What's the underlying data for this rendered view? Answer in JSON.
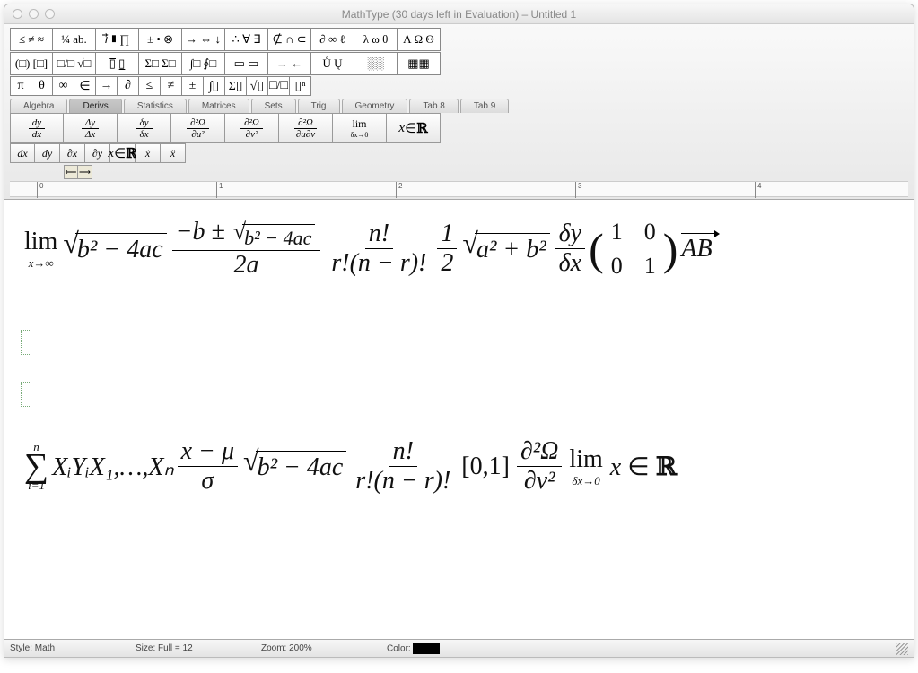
{
  "window": {
    "title": "MathType (30 days left in Evaluation) – Untitled 1"
  },
  "palette": {
    "row1": [
      "≤ ≠ ≈",
      "¼ ab.",
      "𝑖⃗ ∎ ∏",
      "± • ⊗",
      "→ ⇔ ↓",
      "∴ ∀ ∃",
      "∉ ∩ ⊂",
      "∂ ∞ ℓ",
      "λ ω θ",
      "Λ Ω Θ"
    ],
    "row2": [
      "(□) [□]",
      "□/□ √□",
      "▯̅ ▯̲",
      "Σ□ Σ□",
      "∫□ ∮□",
      "▭ ▭",
      "→ ←",
      "Ů Ų",
      "░░",
      "▦▦"
    ],
    "row3": [
      "π",
      "θ",
      "∞",
      "∈",
      "→",
      "∂",
      "≤",
      "≠",
      "±",
      "∫▯",
      "Σ▯",
      "√▯",
      "□/□",
      "▯ⁿ"
    ]
  },
  "tabs": [
    "Algebra",
    "Derivs",
    "Statistics",
    "Matrices",
    "Sets",
    "Trig",
    "Geometry",
    "Tab 8",
    "Tab 9"
  ],
  "active_tab_index": 1,
  "templates": {
    "row1": [
      "dy/dx",
      "Δy/Δx",
      "δy/δx",
      "∂²Ω/∂u²",
      "∂²Ω/∂v²",
      "∂²Ω/∂u∂v",
      "lim δx→0",
      "x ∈ ℝ"
    ],
    "row2": [
      "dx",
      "dy",
      "∂x",
      "∂y",
      "ℝ",
      "ẋ",
      "ẍ"
    ]
  },
  "small_icons": [
    "⟵",
    "⟶"
  ],
  "ruler": [
    "0",
    "1",
    "2",
    "3",
    "4"
  ],
  "equations": {
    "line1": {
      "lim_sub": "x→∞",
      "sqrt1": "b² − 4ac",
      "quad_num_pre": "−b ± ",
      "quad_num_sqrt": "b² − 4ac",
      "quad_den": "2a",
      "binom_num": "n!",
      "binom_den": "r!(n − r)!",
      "half_num": "1",
      "half_den": "2",
      "pyth": "a² + b²",
      "dy": "δy",
      "dx": "δx",
      "m00": "1",
      "m01": "0",
      "m10": "0",
      "m11": "1",
      "vec": "AB"
    },
    "line2": {
      "sum_top": "n",
      "sum_bot": "i=1",
      "terms": "XᵢYᵢX₁,…,Xₙ",
      "z_num": "x − μ",
      "z_den": "σ",
      "sqrt1": "b² − 4ac",
      "binom_num": "n!",
      "binom_den": "r!(n − r)!",
      "interval": "[0,1]",
      "d2_num": "∂²Ω",
      "d2_den": "∂v²",
      "lim_sub": "δx→0",
      "tail": "x ∈ ℝ"
    }
  },
  "status": {
    "style_label": "Style:",
    "style_value": "Math",
    "size_label": "Size:",
    "size_value": "Full = 12",
    "zoom_label": "Zoom:",
    "zoom_value": "200%",
    "color_label": "Color:"
  }
}
